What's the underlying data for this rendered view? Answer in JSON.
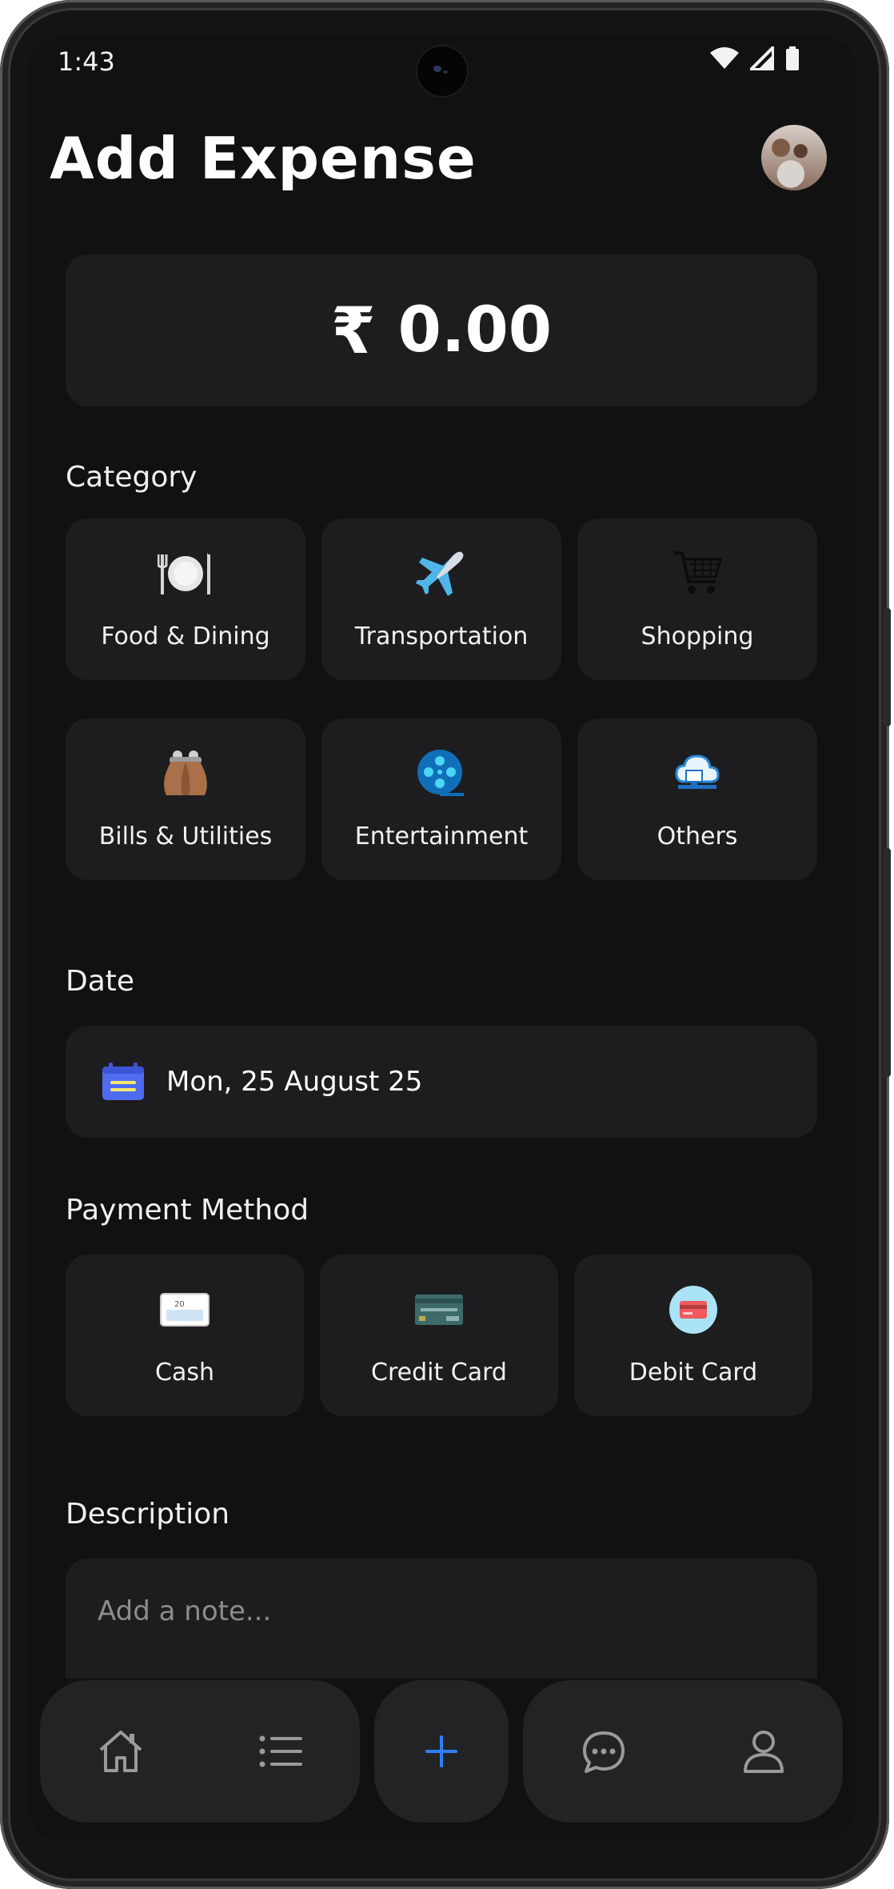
{
  "status_bar": {
    "time": "1:43"
  },
  "header": {
    "title": "Add Expense",
    "avatar": "profile-photo"
  },
  "amount": {
    "currency_symbol": "₹",
    "value": "0.00"
  },
  "category": {
    "label": "Category",
    "items": [
      {
        "label": "Food & Dining",
        "icon": "plate-cutlery-icon"
      },
      {
        "label": "Transportation",
        "icon": "airplane-icon"
      },
      {
        "label": "Shopping",
        "icon": "shopping-cart-icon"
      },
      {
        "label": "Bills & Utilities",
        "icon": "purse-icon"
      },
      {
        "label": "Entertainment",
        "icon": "film-reel-icon"
      },
      {
        "label": "Others",
        "icon": "cloud-computer-icon"
      }
    ]
  },
  "date": {
    "label": "Date",
    "value": "Mon, 25 August 25",
    "icon": "calendar-icon"
  },
  "payment": {
    "label": "Payment Method",
    "items": [
      {
        "label": "Cash",
        "icon": "cash-note-icon",
        "note_value": "20"
      },
      {
        "label": "Credit Card",
        "icon": "credit-card-icon"
      },
      {
        "label": "Debit Card",
        "icon": "debit-card-icon"
      }
    ]
  },
  "description": {
    "label": "Description",
    "placeholder": "Add a note..."
  },
  "nav": {
    "items": [
      "home-icon",
      "list-icon",
      "add-icon",
      "chat-icon",
      "profile-icon"
    ],
    "accent": "#2d7ff9"
  }
}
